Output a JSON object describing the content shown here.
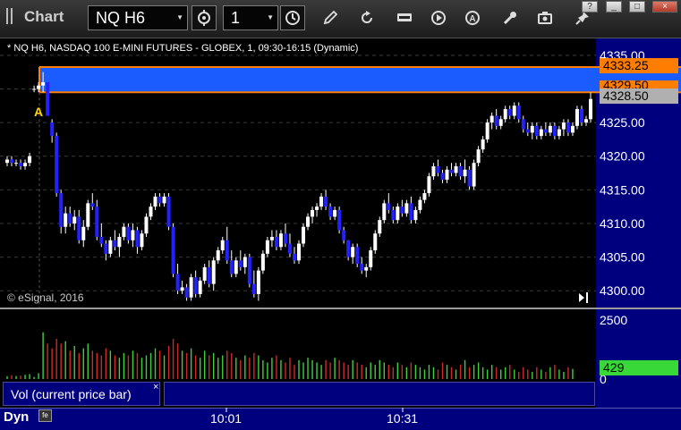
{
  "toolbar": {
    "title": "Chart",
    "symbol": "NQ H6",
    "interval": "1",
    "buttons": [
      "cursor-crosshair-icon",
      "draw-pen-icon",
      "refresh-icon",
      "get-quote-icon",
      "play-icon",
      "alert-icon",
      "tools-icon",
      "snapshot-icon",
      "pin-icon"
    ]
  },
  "window_controls": [
    "?",
    "_",
    "□",
    "×"
  ],
  "chart": {
    "header": "* NQ H6, NASDAQ 100 E-MINI FUTURES - GLOBEX, 1, 09:30-16:15 (Dynamic)",
    "copyright": "© eSignal, 2016",
    "annotation": "A",
    "price_labels": [
      {
        "text": "4333.25",
        "bg": "#ff7d00",
        "fg": "#000000"
      },
      {
        "text": "4329.50",
        "bg": "#ff7d00",
        "fg": "#000000"
      },
      {
        "text": "4328.50",
        "bg": "#b0b0b0",
        "fg": "#000000"
      }
    ],
    "volume_label_box": {
      "text": "429",
      "bg": "#39d839",
      "fg": "#000000"
    },
    "volume_study": "Vol (current price bar)",
    "volume_close": "×",
    "xaxis_labels": [
      "10:01",
      "10:31"
    ],
    "footer": "Dyn",
    "footer_icon": "fe"
  },
  "colors": {
    "up": "#ffffff",
    "down": "#2222ff",
    "zone": "#1a5cff",
    "zone_border": "#ff7d00",
    "axis_bg": "#00007f",
    "vol_up": "#3fcf3f",
    "vol_down": "#cf2a2a"
  },
  "chart_data": {
    "type": "candlestick",
    "title": "NQ H6, NASDAQ 100 E-MINI FUTURES - GLOBEX, 1, 09:30-16:15 (Dynamic)",
    "y_ticks": [
      "4335.00",
      "4330.00",
      "4325.00",
      "4320.00",
      "4315.00",
      "4310.00",
      "4305.00",
      "4300.00"
    ],
    "ylim": [
      4297.5,
      4337.5
    ],
    "volume_ticks": [
      "2500",
      "0"
    ],
    "zone": [
      4329.5,
      4333.25
    ],
    "last_price": 4328.5,
    "candles": [
      [
        4319.0,
        4320.0,
        4318.5,
        4319.5
      ],
      [
        4319.5,
        4320.0,
        4318.5,
        4319.0
      ],
      [
        4319.0,
        4319.5,
        4318.5,
        4319.0
      ],
      [
        4319.0,
        4319.5,
        4318.0,
        4318.5
      ],
      [
        4318.5,
        4319.5,
        4318.0,
        4319.0
      ],
      [
        4319.0,
        4320.5,
        4318.5,
        4320.0
      ],
      [
        4330.0,
        4330.5,
        4329.5,
        4330.0
      ],
      [
        4330.0,
        4331.0,
        4329.5,
        4330.5
      ],
      [
        4330.5,
        4332.5,
        4329.5,
        4331.0
      ],
      [
        4331.0,
        4331.0,
        4326.0,
        4326.0
      ],
      [
        4325.0,
        4325.5,
        4322.0,
        4323.0
      ],
      [
        4323.0,
        4323.5,
        4314.0,
        4314.5
      ],
      [
        4314.5,
        4315.0,
        4308.5,
        4309.5
      ],
      [
        4309.5,
        4312.5,
        4308.5,
        4311.5
      ],
      [
        4311.5,
        4312.5,
        4309.5,
        4310.0
      ],
      [
        4310.0,
        4312.0,
        4309.0,
        4311.0
      ],
      [
        4311.0,
        4312.0,
        4307.0,
        4307.5
      ],
      [
        4307.5,
        4310.5,
        4306.5,
        4309.5
      ],
      [
        4309.5,
        4313.5,
        4309.0,
        4313.0
      ],
      [
        4313.0,
        4314.5,
        4312.0,
        4312.5
      ],
      [
        4312.5,
        4313.5,
        4307.5,
        4308.0
      ],
      [
        4308.0,
        4310.0,
        4306.5,
        4307.0
      ],
      [
        4307.0,
        4307.5,
        4304.5,
        4305.5
      ],
      [
        4305.5,
        4308.0,
        4305.0,
        4307.5
      ],
      [
        4307.5,
        4309.0,
        4306.0,
        4306.5
      ],
      [
        4306.5,
        4308.5,
        4305.0,
        4308.0
      ],
      [
        4308.0,
        4310.0,
        4307.5,
        4309.5
      ],
      [
        4309.5,
        4310.0,
        4307.0,
        4307.5
      ],
      [
        4307.5,
        4310.0,
        4306.5,
        4309.0
      ],
      [
        4309.0,
        4309.5,
        4305.5,
        4306.5
      ],
      [
        4306.5,
        4309.0,
        4306.0,
        4308.5
      ],
      [
        4308.5,
        4311.5,
        4308.0,
        4311.0
      ],
      [
        4311.0,
        4313.0,
        4310.5,
        4312.5
      ],
      [
        4312.5,
        4314.5,
        4312.0,
        4314.0
      ],
      [
        4314.0,
        4314.5,
        4312.5,
        4313.0
      ],
      [
        4313.0,
        4314.5,
        4312.5,
        4314.0
      ],
      [
        4314.0,
        4314.5,
        4309.0,
        4309.5
      ],
      [
        4309.5,
        4310.0,
        4302.0,
        4302.5
      ],
      [
        4302.5,
        4304.0,
        4299.5,
        4300.0
      ],
      [
        4300.0,
        4301.5,
        4299.5,
        4300.5
      ],
      [
        4300.5,
        4301.0,
        4298.5,
        4299.0
      ],
      [
        4299.0,
        4302.5,
        4298.5,
        4302.0
      ],
      [
        4302.0,
        4303.0,
        4299.0,
        4299.5
      ],
      [
        4299.5,
        4302.0,
        4299.0,
        4301.5
      ],
      [
        4301.5,
        4304.0,
        4301.0,
        4303.5
      ],
      [
        4303.5,
        4304.5,
        4300.5,
        4301.0
      ],
      [
        4301.0,
        4305.0,
        4300.0,
        4304.5
      ],
      [
        4304.5,
        4306.5,
        4304.0,
        4306.0
      ],
      [
        4306.0,
        4308.0,
        4305.5,
        4307.5
      ],
      [
        4307.5,
        4309.5,
        4304.0,
        4304.5
      ],
      [
        4304.5,
        4306.0,
        4302.0,
        4302.5
      ],
      [
        4302.5,
        4305.0,
        4302.0,
        4304.5
      ],
      [
        4304.5,
        4306.0,
        4303.0,
        4303.5
      ],
      [
        4303.5,
        4305.5,
        4302.5,
        4305.0
      ],
      [
        4305.0,
        4305.5,
        4300.5,
        4301.0
      ],
      [
        4301.0,
        4303.0,
        4299.0,
        4299.5
      ],
      [
        4299.5,
        4303.5,
        4298.5,
        4303.0
      ],
      [
        4303.0,
        4306.0,
        4302.5,
        4305.5
      ],
      [
        4305.5,
        4308.0,
        4305.0,
        4307.5
      ],
      [
        4307.5,
        4309.0,
        4306.5,
        4308.0
      ],
      [
        4308.0,
        4309.0,
        4306.0,
        4306.5
      ],
      [
        4306.5,
        4309.0,
        4306.0,
        4308.5
      ],
      [
        4308.5,
        4310.0,
        4306.5,
        4307.0
      ],
      [
        4307.0,
        4308.5,
        4305.0,
        4305.5
      ],
      [
        4305.5,
        4306.5,
        4304.0,
        4304.5
      ],
      [
        4304.5,
        4307.5,
        4304.0,
        4307.0
      ],
      [
        4307.0,
        4310.0,
        4306.5,
        4309.5
      ],
      [
        4309.5,
        4311.5,
        4309.0,
        4311.0
      ],
      [
        4311.0,
        4312.5,
        4310.0,
        4312.0
      ],
      [
        4312.0,
        4313.0,
        4311.0,
        4312.5
      ],
      [
        4312.5,
        4314.5,
        4312.0,
        4314.0
      ],
      [
        4314.0,
        4315.0,
        4312.0,
        4312.5
      ],
      [
        4312.5,
        4313.0,
        4310.5,
        4311.0
      ],
      [
        4311.0,
        4312.5,
        4310.5,
        4312.0
      ],
      [
        4312.0,
        4312.5,
        4308.5,
        4309.0
      ],
      [
        4309.0,
        4309.5,
        4307.0,
        4307.5
      ],
      [
        4307.5,
        4307.5,
        4304.5,
        4305.0
      ],
      [
        4305.0,
        4307.0,
        4304.0,
        4306.5
      ],
      [
        4306.5,
        4307.0,
        4303.5,
        4304.0
      ],
      [
        4304.0,
        4305.0,
        4302.5,
        4303.0
      ],
      [
        4303.0,
        4304.0,
        4302.0,
        4303.5
      ],
      [
        4303.5,
        4306.5,
        4303.0,
        4306.0
      ],
      [
        4306.0,
        4309.0,
        4305.5,
        4308.5
      ],
      [
        4308.5,
        4311.0,
        4308.0,
        4310.5
      ],
      [
        4310.5,
        4313.5,
        4310.0,
        4313.0
      ],
      [
        4313.0,
        4314.5,
        4311.5,
        4312.0
      ],
      [
        4312.0,
        4312.5,
        4310.0,
        4310.5
      ],
      [
        4310.5,
        4313.0,
        4310.0,
        4312.5
      ],
      [
        4312.5,
        4313.5,
        4311.0,
        4311.5
      ],
      [
        4311.5,
        4313.5,
        4311.0,
        4313.0
      ],
      [
        4313.0,
        4314.0,
        4310.0,
        4310.5
      ],
      [
        4310.5,
        4312.5,
        4310.0,
        4312.0
      ],
      [
        4312.0,
        4314.0,
        4311.5,
        4313.5
      ],
      [
        4313.5,
        4315.0,
        4313.0,
        4314.5
      ],
      [
        4314.5,
        4317.5,
        4314.0,
        4317.0
      ],
      [
        4317.0,
        4319.0,
        4316.5,
        4318.5
      ],
      [
        4318.5,
        4319.5,
        4317.0,
        4317.5
      ],
      [
        4317.5,
        4318.0,
        4316.0,
        4316.5
      ],
      [
        4316.5,
        4318.5,
        4316.0,
        4318.0
      ],
      [
        4318.0,
        4319.0,
        4317.0,
        4317.5
      ],
      [
        4317.5,
        4319.0,
        4317.0,
        4318.5
      ],
      [
        4318.5,
        4319.0,
        4316.5,
        4317.0
      ],
      [
        4317.0,
        4319.5,
        4316.0,
        4318.0
      ],
      [
        4318.0,
        4318.5,
        4315.0,
        4315.5
      ],
      [
        4315.5,
        4319.5,
        4315.0,
        4319.0
      ],
      [
        4319.0,
        4321.5,
        4318.5,
        4321.0
      ],
      [
        4321.0,
        4323.0,
        4320.5,
        4322.5
      ],
      [
        4322.5,
        4325.5,
        4322.0,
        4325.0
      ],
      [
        4325.0,
        4326.5,
        4324.0,
        4326.0
      ],
      [
        4326.0,
        4327.0,
        4324.0,
        4324.5
      ],
      [
        4324.5,
        4326.0,
        4324.0,
        4325.5
      ],
      [
        4325.5,
        4327.5,
        4325.0,
        4327.0
      ],
      [
        4327.0,
        4327.5,
        4325.5,
        4326.0
      ],
      [
        4326.0,
        4328.0,
        4325.5,
        4327.5
      ],
      [
        4327.5,
        4328.0,
        4325.0,
        4325.5
      ],
      [
        4325.5,
        4326.0,
        4323.5,
        4324.0
      ],
      [
        4324.0,
        4325.0,
        4323.0,
        4323.5
      ],
      [
        4323.5,
        4325.0,
        4322.5,
        4324.5
      ],
      [
        4324.5,
        4325.0,
        4322.5,
        4323.0
      ],
      [
        4323.0,
        4324.5,
        4322.5,
        4324.0
      ],
      [
        4324.0,
        4325.0,
        4323.0,
        4323.5
      ],
      [
        4323.5,
        4325.0,
        4323.0,
        4324.5
      ],
      [
        4324.5,
        4325.0,
        4322.5,
        4323.0
      ],
      [
        4323.0,
        4324.5,
        4322.5,
        4324.0
      ],
      [
        4324.0,
        4325.5,
        4323.0,
        4325.0
      ],
      [
        4325.0,
        4325.5,
        4323.0,
        4323.5
      ],
      [
        4323.5,
        4325.0,
        4323.0,
        4324.5
      ],
      [
        4324.5,
        4327.5,
        4324.0,
        4327.0
      ],
      [
        4327.0,
        4327.5,
        4324.5,
        4325.0
      ],
      [
        4325.0,
        4326.0,
        4324.5,
        4325.5
      ],
      [
        4325.5,
        4329.5,
        4325.0,
        4328.5
      ]
    ],
    "volume": [
      120,
      160,
      130,
      140,
      180,
      210,
      90,
      250,
      1980,
      1500,
      1300,
      1700,
      1500,
      1600,
      1200,
      1400,
      1100,
      1300,
      1500,
      1200,
      1100,
      1000,
      1300,
      1200,
      1000,
      900,
      1100,
      1000,
      1200,
      1100,
      900,
      1000,
      1100,
      1300,
      1200,
      1000,
      1400,
      1700,
      1500,
      1200,
      1100,
      1300,
      1000,
      900,
      1200,
      1000,
      1100,
      900,
      1000,
      1200,
      1100,
      900,
      800,
      1000,
      900,
      1100,
      1000,
      800,
      700,
      900,
      1000,
      800,
      700,
      900,
      600,
      800,
      700,
      900,
      800,
      700,
      600,
      800,
      700,
      900,
      800,
      700,
      600,
      800,
      700,
      600,
      500,
      700,
      600,
      800,
      700,
      600,
      500,
      700,
      600,
      500,
      700,
      600,
      500,
      400,
      600,
      500,
      400,
      700,
      600,
      500,
      400,
      600,
      800,
      500,
      600,
      700,
      500,
      400,
      600,
      500,
      400,
      500,
      600,
      400,
      300,
      500,
      400,
      300,
      500,
      400,
      300,
      500,
      600,
      400,
      300,
      500,
      429
    ]
  }
}
